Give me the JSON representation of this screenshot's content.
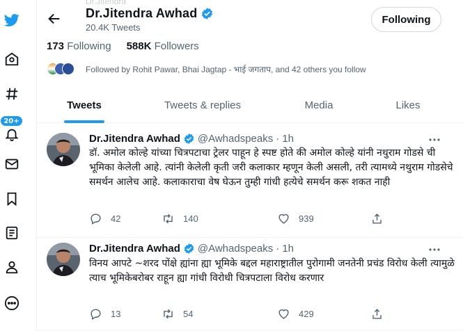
{
  "profile": {
    "ghost_text": "Dr.Jitendra",
    "name": "Dr.Jitendra Awhad",
    "tweet_count": "20.4K Tweets",
    "follow_button": "Following",
    "following_count": "173",
    "following_label": "Following",
    "followers_count": "588K",
    "followers_label": "Followers",
    "followed_by": "Followed by Rohit Pawar, Bhai Jagtap - भाई जगताप, and 42 others you follow"
  },
  "rail": {
    "badge": "20+",
    "icons": [
      "twitter-logo-icon",
      "explore-icon",
      "hashtag-icon",
      "notifications-icon",
      "messages-icon",
      "bookmarks-icon",
      "lists-icon",
      "profile-icon",
      "more-icon"
    ]
  },
  "tabs": [
    {
      "label": "Tweets",
      "active": true
    },
    {
      "label": "Tweets & replies",
      "active": false
    },
    {
      "label": "Media",
      "active": false
    },
    {
      "label": "Likes",
      "active": false
    }
  ],
  "tweets": [
    {
      "name": "Dr.Jitendra Awhad",
      "handle": "@Awhadspeaks",
      "dot": "·",
      "time": "1h",
      "text": "डॉ. अमोल कोल्हे यांच्या चित्रपटाचा ट्रेलर पाहून हे स्पष्ट होते की अमोल कोल्हे यांनी नथुराम गोडसे ची भूमिका  केलेली आहे. त्यांनी केलेली कृती जरी कलाकार म्हणून केली असली, तरी त्यामध्ये नथुराम गोडसेचे समर्थन आलेच आहे. कलाकाराचा वेष घेऊन तुम्ही गांधी हत्येचे समर्थन करू शकत नाही",
      "replies": "42",
      "retweets": "140",
      "likes": "939"
    },
    {
      "name": "Dr.Jitendra Awhad",
      "handle": "@Awhadspeaks",
      "dot": "·",
      "time": "1h",
      "text": "विनय आपटे ~शरद पोंक्षे ह्यांना ह्या भूमिके बद्दल महाराष्ट्रातील पुरोगामी जनतेनी प्रचंड विरोध केली त्यामुळे त्याच भूमिकेबरोबर राहून ह्या गांधी विरोधी चित्रपटाला विरोध करणार",
      "replies": "13",
      "retweets": "54",
      "likes": "429"
    }
  ],
  "colors": {
    "accent": "#1d9bf0",
    "text": "#0f1419",
    "muted": "#536471",
    "border": "#eff3f4"
  }
}
